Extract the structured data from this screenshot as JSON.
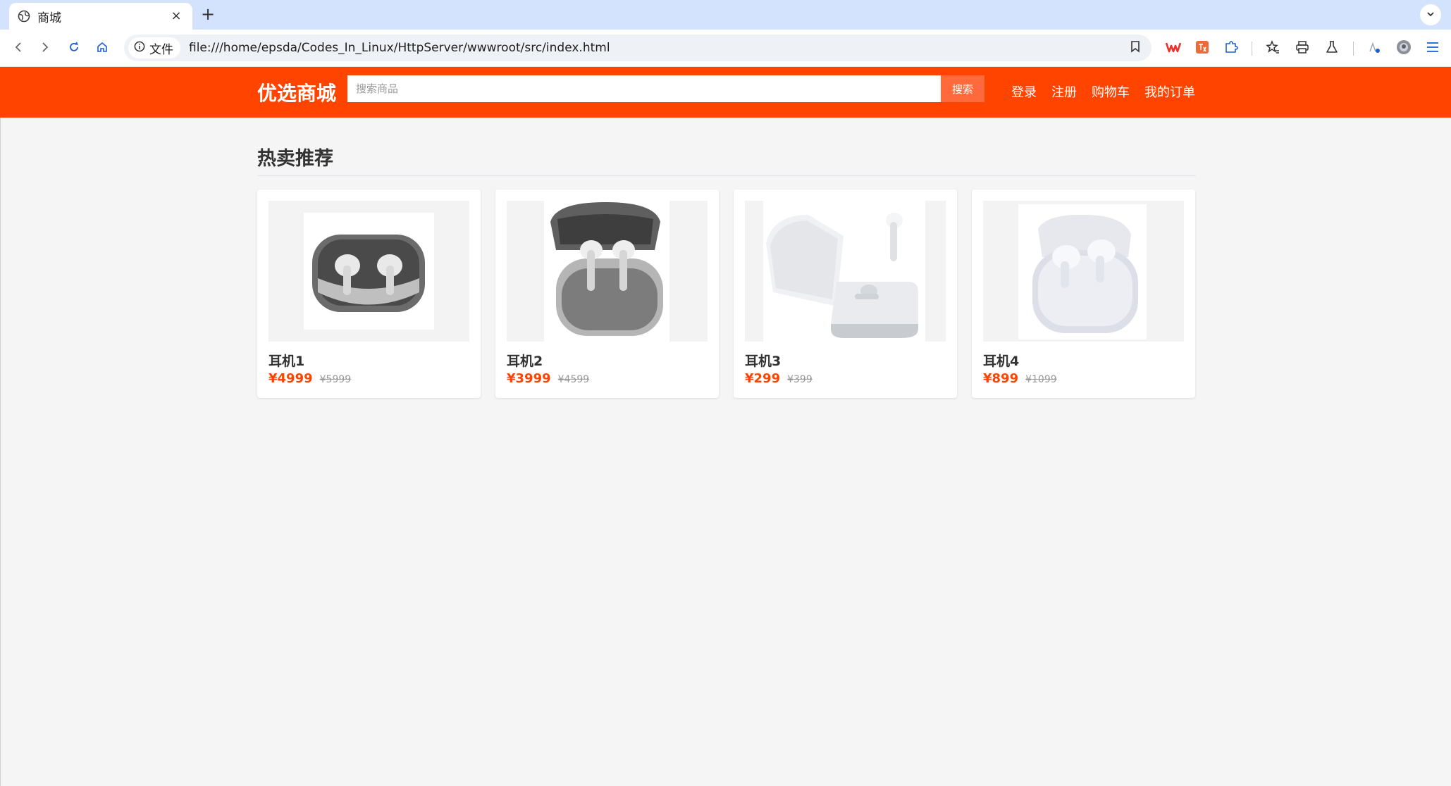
{
  "browser": {
    "tab": {
      "title": "商城",
      "close": "×"
    },
    "new_tab": "+",
    "site_info_label": "文件",
    "url": "file:///home/epsda/Codes_In_Linux/HttpServer/wwwroot/src/index.html"
  },
  "header": {
    "logo": "优选商城",
    "search_placeholder": "搜索商品",
    "search_button": "搜索",
    "links": [
      "登录",
      "注册",
      "购物车",
      "我的订单"
    ],
    "brand_color": "#ff4400"
  },
  "section": {
    "title": "热卖推荐"
  },
  "products": [
    {
      "name": "耳机1",
      "price": "¥4999",
      "old_price": "¥5999"
    },
    {
      "name": "耳机2",
      "price": "¥3999",
      "old_price": "¥4599"
    },
    {
      "name": "耳机3",
      "price": "¥299",
      "old_price": "¥399"
    },
    {
      "name": "耳机4",
      "price": "¥899",
      "old_price": "¥1099"
    }
  ]
}
